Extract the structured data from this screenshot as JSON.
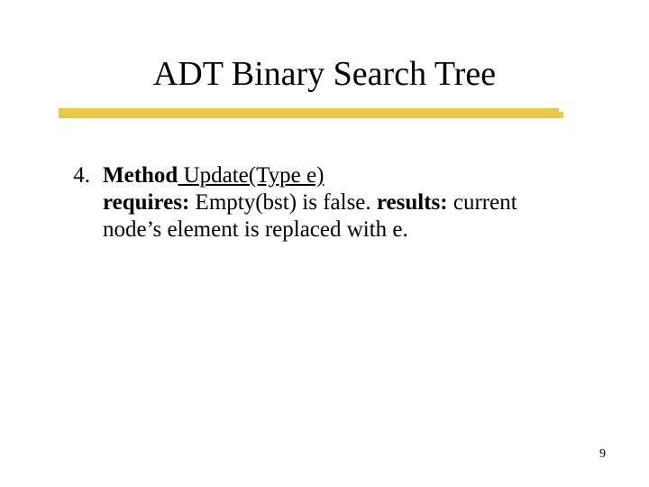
{
  "title": "ADT Binary Search Tree",
  "item": {
    "number": "4.",
    "method_label": "Method",
    "signature": " Update(Type e)",
    "requires_label": "requires:",
    "requires_text": " Empty(bst) is false. ",
    "results_label": "results:",
    "results_text": " current node’s element is replaced with e."
  },
  "page_number": "9"
}
